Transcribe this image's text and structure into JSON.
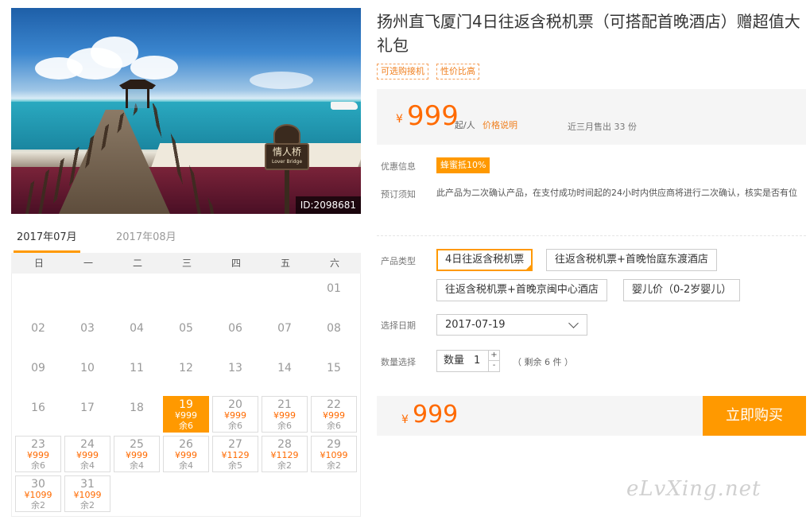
{
  "photo": {
    "sign_text": "情人桥",
    "sign_sub": "Lover Bridge",
    "id_label": "ID:2098681"
  },
  "calendar": {
    "tabs": [
      "2017年07月",
      "2017年08月"
    ],
    "weekdays": [
      "日",
      "一",
      "二",
      "三",
      "四",
      "五",
      "六"
    ],
    "plain_days": [
      {
        "day": "01",
        "col": 6,
        "row": 0
      },
      {
        "day": "02",
        "col": 0,
        "row": 1
      },
      {
        "day": "03",
        "col": 1,
        "row": 1
      },
      {
        "day": "04",
        "col": 2,
        "row": 1
      },
      {
        "day": "05",
        "col": 3,
        "row": 1
      },
      {
        "day": "06",
        "col": 4,
        "row": 1
      },
      {
        "day": "07",
        "col": 5,
        "row": 1
      },
      {
        "day": "08",
        "col": 6,
        "row": 1
      },
      {
        "day": "09",
        "col": 0,
        "row": 2
      },
      {
        "day": "10",
        "col": 1,
        "row": 2
      },
      {
        "day": "11",
        "col": 2,
        "row": 2
      },
      {
        "day": "12",
        "col": 3,
        "row": 2
      },
      {
        "day": "13",
        "col": 4,
        "row": 2
      },
      {
        "day": "14",
        "col": 5,
        "row": 2
      },
      {
        "day": "15",
        "col": 6,
        "row": 2
      },
      {
        "day": "16",
        "col": 0,
        "row": 3
      },
      {
        "day": "17",
        "col": 1,
        "row": 3
      },
      {
        "day": "18",
        "col": 2,
        "row": 3
      }
    ],
    "priced_days": [
      {
        "day": "19",
        "price": "¥999",
        "remain": "余6",
        "col": 3,
        "row": 3,
        "selected": true
      },
      {
        "day": "20",
        "price": "¥999",
        "remain": "余6",
        "col": 4,
        "row": 3
      },
      {
        "day": "21",
        "price": "¥999",
        "remain": "余6",
        "col": 5,
        "row": 3
      },
      {
        "day": "22",
        "price": "¥999",
        "remain": "余6",
        "col": 6,
        "row": 3
      },
      {
        "day": "23",
        "price": "¥999",
        "remain": "余6",
        "col": 0,
        "row": 4
      },
      {
        "day": "24",
        "price": "¥999",
        "remain": "余4",
        "col": 1,
        "row": 4
      },
      {
        "day": "25",
        "price": "¥999",
        "remain": "余4",
        "col": 2,
        "row": 4
      },
      {
        "day": "26",
        "price": "¥999",
        "remain": "余4",
        "col": 3,
        "row": 4
      },
      {
        "day": "27",
        "price": "¥1129",
        "remain": "余5",
        "col": 4,
        "row": 4
      },
      {
        "day": "28",
        "price": "¥1129",
        "remain": "余2",
        "col": 5,
        "row": 4
      },
      {
        "day": "29",
        "price": "¥1099",
        "remain": "余2",
        "col": 6,
        "row": 4
      },
      {
        "day": "30",
        "price": "¥1099",
        "remain": "余2",
        "col": 0,
        "row": 5
      },
      {
        "day": "31",
        "price": "¥1099",
        "remain": "余2",
        "col": 1,
        "row": 5
      }
    ]
  },
  "product": {
    "title": "扬州直飞厦门4日往返含税机票（可搭配首晚酒店）赠超值大礼包",
    "tags": [
      "可选购接机",
      "性价比高"
    ],
    "price_symbol": "¥",
    "price": "999",
    "price_unit": "起/人",
    "price_explain": "价格说明",
    "sold": "近三月售出 33 份",
    "discount_label": "优惠信息",
    "discount_badge": "蜂蜜抵10%",
    "notice_label": "预订须知",
    "notice_text": "此产品为二次确认产品，在支付成功时间起的24小时内供应商将进行二次确认，核实是否有位",
    "type_label": "产品类型",
    "types": [
      "4日往返含税机票",
      "往返含税机票+首晚怡庭东渡酒店",
      "往返含税机票+首晚京闽中心酒店",
      "婴儿价（0-2岁婴儿）"
    ],
    "date_label": "选择日期",
    "date_value": "2017-07-19",
    "qty_label": "数量选择",
    "qty_inner_label": "数量",
    "qty_value": "1",
    "qty_plus": "+",
    "qty_minus": "-",
    "qty_remain": "（ 剩余 6 件 ）",
    "total_symbol": "¥",
    "total": "999",
    "buy_label": "立即购买"
  },
  "watermark": "eLvXing.net",
  "colors": {
    "accent": "#ff9900",
    "price": "#ff6a00"
  }
}
